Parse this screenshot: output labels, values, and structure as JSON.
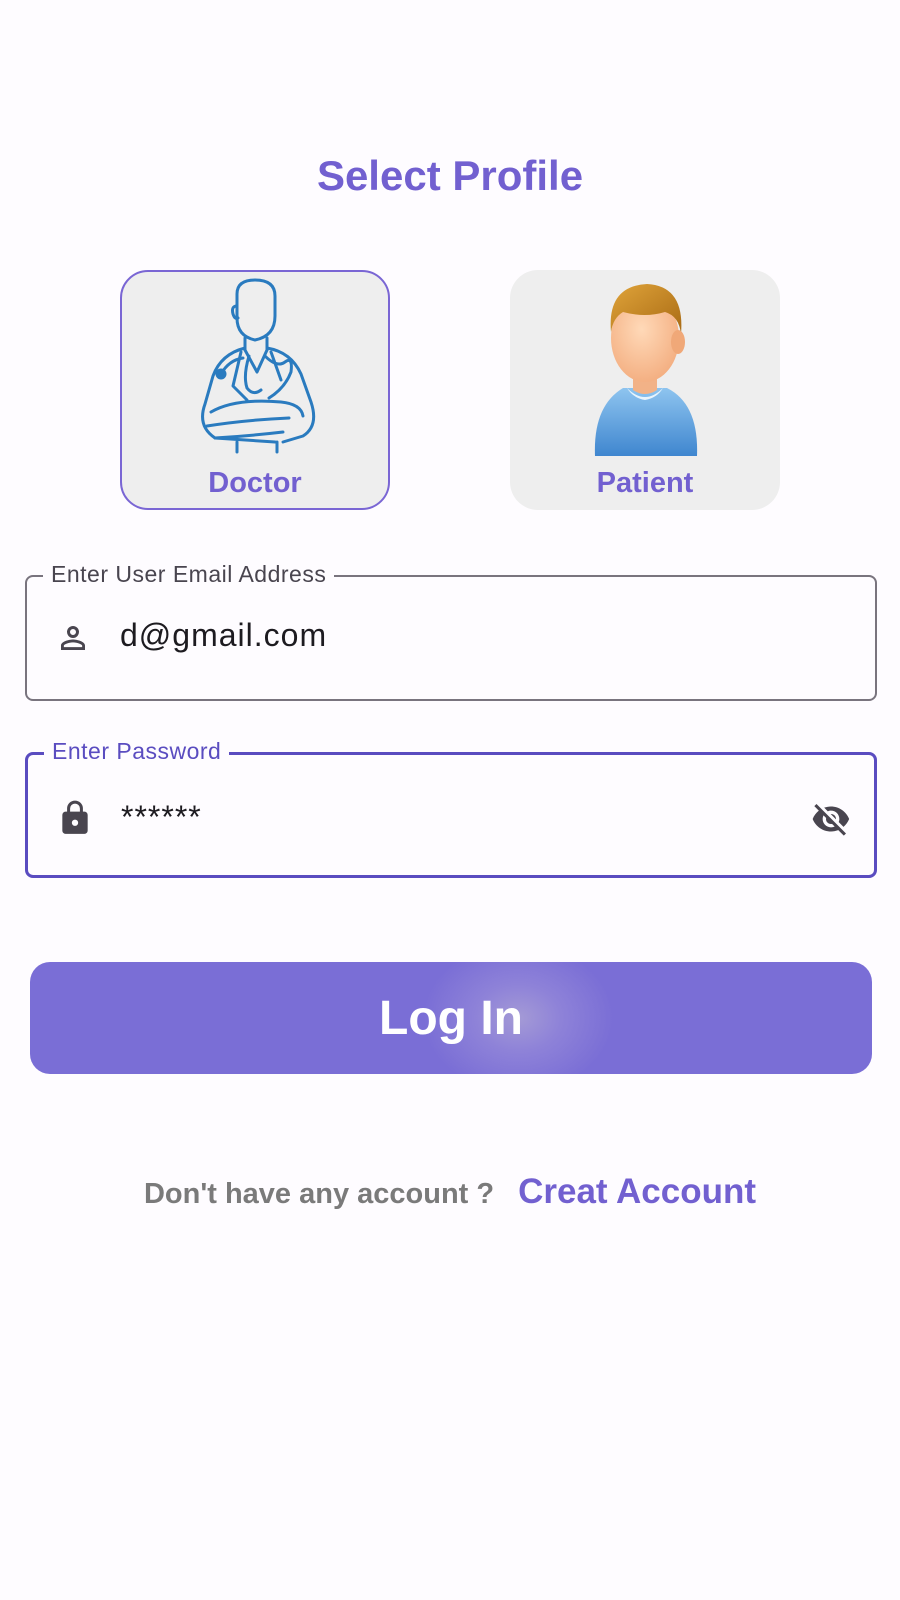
{
  "header": {
    "title": "Select Profile"
  },
  "profiles": [
    {
      "label": "Doctor",
      "selected": true
    },
    {
      "label": "Patient",
      "selected": false
    }
  ],
  "email_field": {
    "label": "Enter User Email Address",
    "value": "d@gmail.com",
    "icon": "person-outline-icon"
  },
  "password_field": {
    "label": "Enter Password",
    "value": "******",
    "icon": "lock-icon",
    "trailing_icon": "visibility-off-icon"
  },
  "login_button": {
    "label": "Log In"
  },
  "footer": {
    "text": "Don't have any account ?",
    "link": "Creat Account"
  },
  "colors": {
    "accent": "#7260d0",
    "button": "#7a6ed6",
    "focus_border": "#5a4cc0",
    "card_bg": "#eeeeee"
  }
}
